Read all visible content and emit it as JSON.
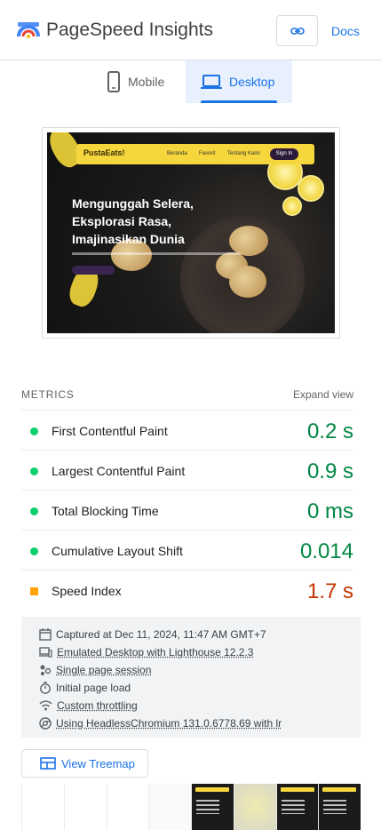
{
  "header": {
    "brand": "PageSpeed Insights",
    "docs_label": "Docs",
    "link_icon": "link-icon",
    "logo_colors": [
      "#4285f4",
      "#ea4335",
      "#fbbc04"
    ]
  },
  "tabs": [
    {
      "label": "Mobile",
      "icon": "phone-icon",
      "active": false
    },
    {
      "label": "Desktop",
      "icon": "laptop-icon",
      "active": true
    }
  ],
  "screenshot": {
    "brand": "PustaEats!",
    "nav_links": [
      "Beranda",
      "Favorit",
      "Tentang Kami"
    ],
    "signin": "Sign In",
    "hero_lines": [
      "Mengunggah Selera,",
      "Eksplorasi Rasa,",
      "Imajinasikan Dunia"
    ]
  },
  "metrics": {
    "title": "METRICS",
    "expand_label": "Expand view",
    "items": [
      {
        "label": "First Contentful Paint",
        "value": "0.2 s",
        "status": "good"
      },
      {
        "label": "Largest Contentful Paint",
        "value": "0.9 s",
        "status": "good"
      },
      {
        "label": "Total Blocking Time",
        "value": "0 ms",
        "status": "good"
      },
      {
        "label": "Cumulative Layout Shift",
        "value": "0.014",
        "status": "good"
      },
      {
        "label": "Speed Index",
        "value": "1.7 s",
        "status": "average"
      }
    ],
    "colors": {
      "good": "#0cce6b",
      "average": "#ffa400"
    }
  },
  "info": [
    {
      "icon": "calendar-icon",
      "text": "Captured at Dec 11, 2024, 11:47 AM GMT+7"
    },
    {
      "icon": "devices-icon",
      "text": "Emulated Desktop with Lighthouse 12.2.3"
    },
    {
      "icon": "session-icon",
      "text": "Single page session"
    },
    {
      "icon": "timer-icon",
      "text": "Initial page load"
    },
    {
      "icon": "network-icon",
      "text": "Custom throttling"
    },
    {
      "icon": "chrome-icon",
      "text": "Using HeadlessChromium 131.0.6778.69 with lr"
    }
  ],
  "treemap_label": "View Treemap"
}
